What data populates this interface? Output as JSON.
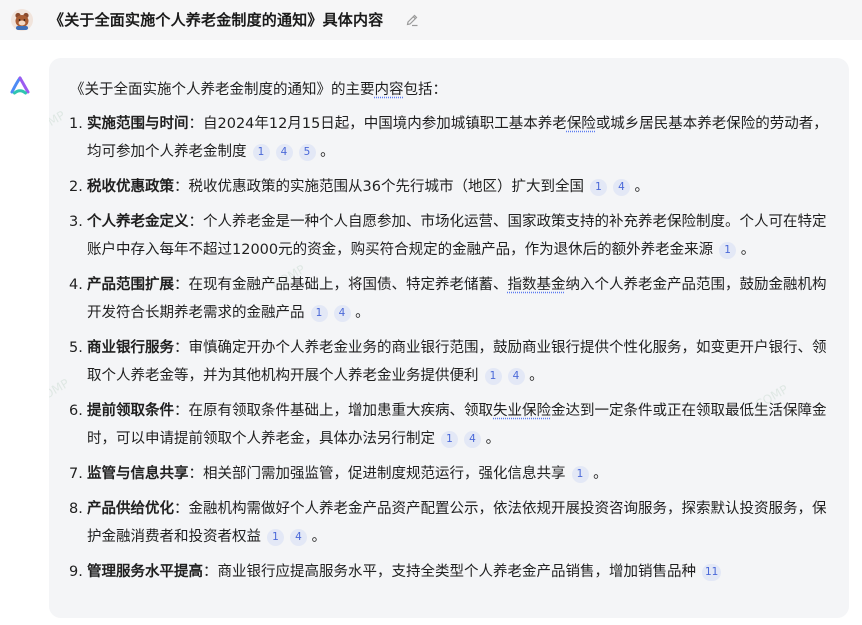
{
  "header": {
    "title": "《关于全面实施个人养老金制度的通知》具体内容"
  },
  "answer": {
    "intro_before": "《关于全面实施个人养老金制度的通知》的主要",
    "intro_link": "内容",
    "intro_after": "包括：",
    "points": [
      {
        "num": "1.",
        "title": "实施范围与时间",
        "segments": [
          {
            "text": "：自2024年12月15日起，中国境内参加城镇职工基本养老"
          },
          {
            "text": "保险",
            "link": true
          },
          {
            "text": "或城乡居民基本养老保险的劳动者，均可参加个人养老金制度"
          }
        ],
        "cites": [
          "1",
          "4",
          "5"
        ]
      },
      {
        "num": "2.",
        "title": "税收优惠政策",
        "segments": [
          {
            "text": "：税收优惠政策的实施范围从36个先行城市（地区）扩大到全国"
          }
        ],
        "cites": [
          "1",
          "4"
        ]
      },
      {
        "num": "3.",
        "title": "个人养老金定义",
        "segments": [
          {
            "text": "：个人养老金是一种个人自愿参加、市场化运营、国家政策支持的补充养老保险制度。个人可在特定账户中存入每年不超过12000元的资金，购买符合规定的金融产品，作为退休后的额外养老金来源"
          }
        ],
        "cites": [
          "1"
        ]
      },
      {
        "num": "4.",
        "title": "产品范围扩展",
        "segments": [
          {
            "text": "：在现有金融产品基础上，将国债、特定养老储蓄、"
          },
          {
            "text": "指数基金",
            "link": true
          },
          {
            "text": "纳入个人养老金产品范围，鼓励金融机构开发符合长期养老需求的金融产品"
          }
        ],
        "cites": [
          "1",
          "4"
        ]
      },
      {
        "num": "5.",
        "title": "商业银行服务",
        "segments": [
          {
            "text": "：审慎确定开办个人养老金业务的商业银行范围，鼓励商业银行提供个性化服务，如变更开户银行、领取个人养老金等，并为其他机构开展个人养老金业务提供便利"
          }
        ],
        "cites": [
          "1",
          "4"
        ]
      },
      {
        "num": "6.",
        "title": "提前领取条件",
        "segments": [
          {
            "text": "：在原有领取条件基础上，增加患重大疾病、领取"
          },
          {
            "text": "失业保险",
            "link": true
          },
          {
            "text": "金达到一定条件或正在领取最低生活保障金时，可以申请提前领取个人养老金，具体办法另行制定"
          }
        ],
        "cites": [
          "1",
          "4"
        ]
      },
      {
        "num": "7.",
        "title": "监管与信息共享",
        "segments": [
          {
            "text": "：相关部门需加强监管，促进制度规范运行，强化信息共享"
          }
        ],
        "cites": [
          "1"
        ]
      },
      {
        "num": "8.",
        "title": "产品供给优化",
        "segments": [
          {
            "text": "：金融机构需做好个人养老金产品资产配置公示，依法依规开展投资咨询服务，探索默认投资服务，保护金融消费者和投资者权益"
          }
        ],
        "cites": [
          "1",
          "4"
        ]
      },
      {
        "num": "9.",
        "title": "管理服务水平提高",
        "segments": [
          {
            "text": "：商业银行应提高服务水平，支持全类型个人养老金产品销售，增加销售品种"
          }
        ],
        "cites": [
          "11"
        ]
      }
    ]
  },
  "colors": {
    "accent": "#4a68d8",
    "bubble": "#f4f5f7",
    "header_bg": "#f6f6f7"
  },
  "icons": {
    "user": "user-avatar-icon",
    "bot": "assistant-logo-icon",
    "edit": "edit-pencil-icon"
  }
}
